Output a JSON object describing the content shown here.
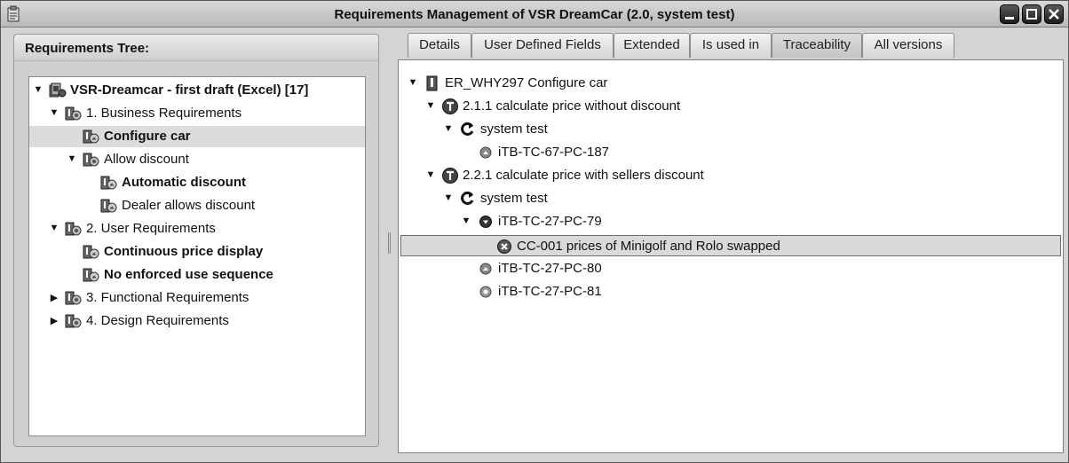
{
  "window": {
    "title": "Requirements Management of VSR DreamCar (2.0, system test)",
    "controls": [
      "minimize",
      "maximize",
      "close"
    ]
  },
  "left_panel": {
    "title": "Requirements Tree:",
    "tree": [
      {
        "label": "VSR-Dreamcar - first draft (Excel) [17]",
        "bold": true,
        "icon": "project-icon",
        "expanded": true
      },
      {
        "label": "1. Business Requirements",
        "icon": "requirement-folder-icon",
        "expanded": true
      },
      {
        "label": "Configure car",
        "bold": true,
        "icon": "requirement-icon",
        "selected": true
      },
      {
        "label": "Allow discount",
        "icon": "requirement-folder-icon",
        "expanded": true
      },
      {
        "label": "Automatic discount",
        "bold": true,
        "icon": "requirement-icon"
      },
      {
        "label": "Dealer allows discount",
        "icon": "requirement-icon"
      },
      {
        "label": "2. User Requirements",
        "icon": "requirement-folder-icon",
        "expanded": true
      },
      {
        "label": "Continuous price display",
        "bold": true,
        "icon": "requirement-icon"
      },
      {
        "label": "No enforced use sequence",
        "bold": true,
        "icon": "requirement-icon"
      },
      {
        "label": "3. Functional Requirements",
        "icon": "requirement-folder-icon",
        "expanded": false
      },
      {
        "label": "4. Design Requirements",
        "icon": "requirement-folder-icon",
        "expanded": false
      }
    ]
  },
  "tabs": [
    {
      "label": "Details"
    },
    {
      "label": "User Defined Fields"
    },
    {
      "label": "Extended"
    },
    {
      "label": "Is used in"
    },
    {
      "label": "Traceability",
      "active": true
    },
    {
      "label": "All versions"
    }
  ],
  "traceability": {
    "tree": [
      {
        "label": "ER_WHY297 Configure car",
        "icon": "requirement-doc-icon",
        "expanded": true
      },
      {
        "label": "2.1.1 calculate price without discount",
        "icon": "test-theme-icon",
        "expanded": true
      },
      {
        "label": "system test",
        "icon": "test-cycle-icon",
        "expanded": true
      },
      {
        "label": "iTB-TC-67-PC-187",
        "icon": "test-case-passed-icon"
      },
      {
        "label": "2.2.1 calculate price with sellers discount",
        "icon": "test-theme-icon",
        "expanded": true
      },
      {
        "label": "system test",
        "icon": "test-cycle-icon",
        "expanded": true
      },
      {
        "label": "iTB-TC-27-PC-79",
        "icon": "test-case-failed-icon",
        "expanded": true
      },
      {
        "label": "CC-001 prices of Minigolf and Rolo swapped",
        "icon": "defect-icon",
        "selected": true
      },
      {
        "label": "iTB-TC-27-PC-80",
        "icon": "test-case-passed-icon"
      },
      {
        "label": "iTB-TC-27-PC-81",
        "icon": "test-case-open-icon"
      }
    ]
  }
}
